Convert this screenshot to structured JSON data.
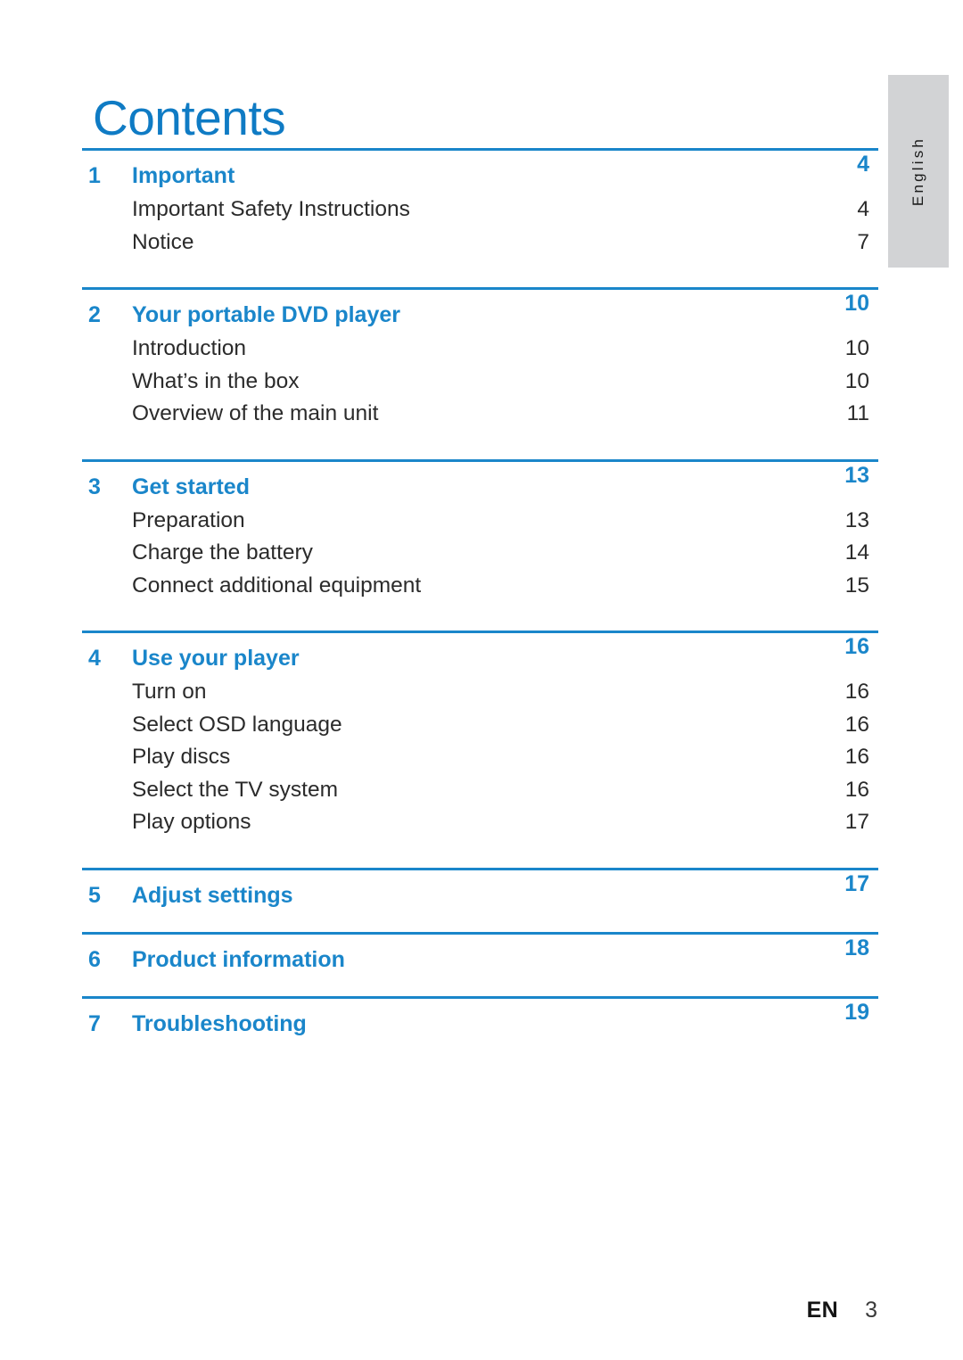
{
  "page": {
    "title": "Contents",
    "accent_color": "#1a86ca",
    "title_color": "#0f7bc4",
    "tab_color": "#d2d3d5",
    "background_color": "#ffffff"
  },
  "language_tab": {
    "label": "English"
  },
  "footer": {
    "language_code": "EN",
    "page_number": "3"
  },
  "toc": {
    "sections": [
      {
        "number": "1",
        "title": "Important",
        "page": "4",
        "items": [
          {
            "title": "Important Safety Instructions",
            "page": "4"
          },
          {
            "title": "Notice",
            "page": "7"
          }
        ]
      },
      {
        "number": "2",
        "title": "Your portable DVD player",
        "page": "10",
        "items": [
          {
            "title": "Introduction",
            "page": "10"
          },
          {
            "title": "What’s in the box",
            "page": "10"
          },
          {
            "title": "Overview of the main unit",
            "page": "11"
          }
        ]
      },
      {
        "number": "3",
        "title": "Get started",
        "page": "13",
        "items": [
          {
            "title": "Preparation",
            "page": "13"
          },
          {
            "title": "Charge the battery",
            "page": "14"
          },
          {
            "title": "Connect additional equipment",
            "page": "15"
          }
        ]
      },
      {
        "number": "4",
        "title": "Use your player",
        "page": "16",
        "items": [
          {
            "title": "Turn on",
            "page": "16"
          },
          {
            "title": "Select OSD language",
            "page": "16"
          },
          {
            "title": "Play discs",
            "page": "16"
          },
          {
            "title": "Select the TV system",
            "page": "16"
          },
          {
            "title": "Play options",
            "page": "17"
          }
        ]
      },
      {
        "number": "5",
        "title": "Adjust settings",
        "page": "17",
        "items": []
      },
      {
        "number": "6",
        "title": "Product information",
        "page": "18",
        "items": []
      },
      {
        "number": "7",
        "title": "Troubleshooting",
        "page": "19",
        "items": []
      }
    ]
  }
}
